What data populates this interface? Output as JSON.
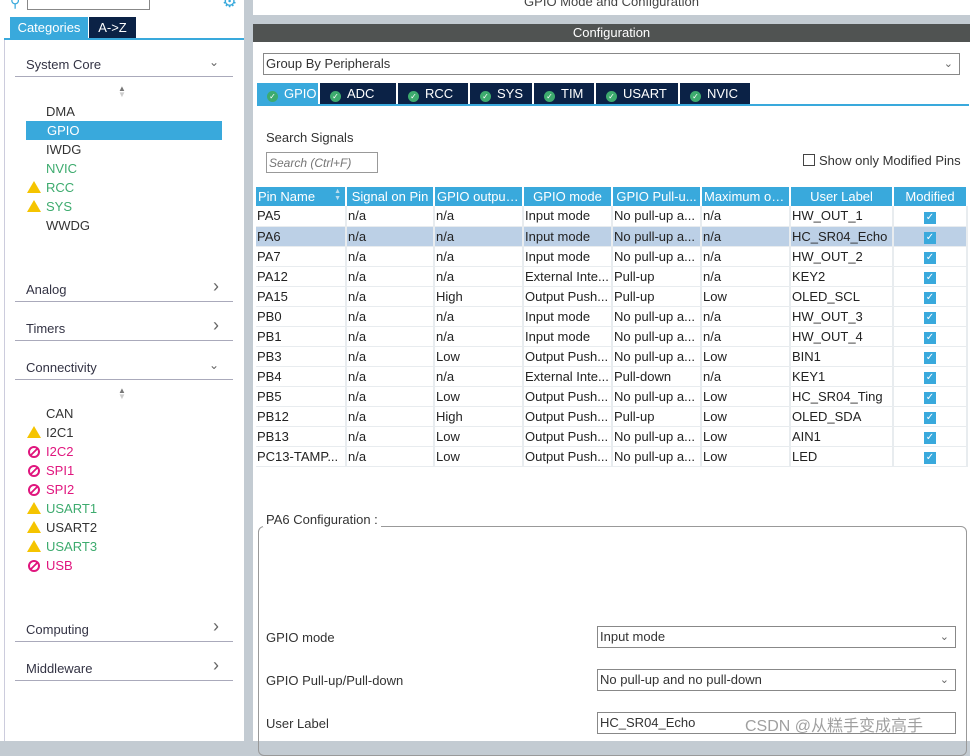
{
  "left": {
    "tabs": [
      {
        "label": "Categories",
        "active": true
      },
      {
        "label": "A->Z",
        "active": false
      }
    ],
    "categories": [
      {
        "label": "System Core",
        "expanded": true,
        "items": [
          {
            "label": "DMA",
            "status": "none",
            "color": "#333333"
          },
          {
            "label": "GPIO",
            "status": "none",
            "selected": true
          },
          {
            "label": "IWDG",
            "status": "none",
            "color": "#333333"
          },
          {
            "label": "NVIC",
            "status": "none",
            "color": "#3dab6e"
          },
          {
            "label": "RCC",
            "status": "warning",
            "color": "#3dab6e"
          },
          {
            "label": "SYS",
            "status": "warning",
            "color": "#3dab6e"
          },
          {
            "label": "WWDG",
            "status": "none",
            "color": "#333333"
          }
        ]
      },
      {
        "label": "Analog",
        "expanded": false
      },
      {
        "label": "Timers",
        "expanded": false
      },
      {
        "label": "Connectivity",
        "expanded": true,
        "items": [
          {
            "label": "CAN",
            "status": "none",
            "color": "#333333"
          },
          {
            "label": "I2C1",
            "status": "warning",
            "color": "#333333"
          },
          {
            "label": "I2C2",
            "status": "disabled",
            "color": "#e0167e"
          },
          {
            "label": "SPI1",
            "status": "disabled",
            "color": "#e0167e"
          },
          {
            "label": "SPI2",
            "status": "disabled",
            "color": "#e0167e"
          },
          {
            "label": "USART1",
            "status": "warning",
            "color": "#3dab6e"
          },
          {
            "label": "USART2",
            "status": "warning",
            "color": "#333333"
          },
          {
            "label": "USART3",
            "status": "warning",
            "color": "#3dab6e"
          },
          {
            "label": "USB",
            "status": "disabled",
            "color": "#e0167e"
          }
        ]
      },
      {
        "label": "Computing",
        "expanded": false
      },
      {
        "label": "Middleware",
        "expanded": false
      }
    ]
  },
  "right": {
    "title": "GPIO Mode and Configuration",
    "config_header": "Configuration",
    "group_by": "Group By Peripherals",
    "tabs": [
      "GPIO",
      "ADC",
      "RCC",
      "SYS",
      "TIM",
      "USART",
      "NVIC"
    ],
    "active_tab": "GPIO",
    "search_label": "Search Signals",
    "search_placeholder": "Search (Ctrl+F)",
    "show_modified_label": "Show only Modified Pins",
    "table": {
      "columns": [
        "Pin Name",
        "Signal on Pin",
        "GPIO output...",
        "GPIO mode",
        "GPIO Pull-u...",
        "Maximum ou...",
        "User Label",
        "Modified"
      ],
      "rows": [
        [
          "PA5",
          "n/a",
          "n/a",
          "Input mode",
          "No pull-up a...",
          "n/a",
          "HW_OUT_1",
          true
        ],
        [
          "PA6",
          "n/a",
          "n/a",
          "Input mode",
          "No pull-up a...",
          "n/a",
          "HC_SR04_Echo",
          true
        ],
        [
          "PA7",
          "n/a",
          "n/a",
          "Input mode",
          "No pull-up a...",
          "n/a",
          "HW_OUT_2",
          true
        ],
        [
          "PA12",
          "n/a",
          "n/a",
          "External Inte...",
          "Pull-up",
          "n/a",
          "KEY2",
          true
        ],
        [
          "PA15",
          "n/a",
          "High",
          "Output Push...",
          "Pull-up",
          "Low",
          "OLED_SCL",
          true
        ],
        [
          "PB0",
          "n/a",
          "n/a",
          "Input mode",
          "No pull-up a...",
          "n/a",
          "HW_OUT_3",
          true
        ],
        [
          "PB1",
          "n/a",
          "n/a",
          "Input mode",
          "No pull-up a...",
          "n/a",
          "HW_OUT_4",
          true
        ],
        [
          "PB3",
          "n/a",
          "Low",
          "Output Push...",
          "No pull-up a...",
          "Low",
          "BIN1",
          true
        ],
        [
          "PB4",
          "n/a",
          "n/a",
          "External Inte...",
          "Pull-down",
          "n/a",
          "KEY1",
          true
        ],
        [
          "PB5",
          "n/a",
          "Low",
          "Output Push...",
          "No pull-up a...",
          "Low",
          "HC_SR04_Ting",
          true
        ],
        [
          "PB12",
          "n/a",
          "High",
          "Output Push...",
          "Pull-up",
          "Low",
          "OLED_SDA",
          true
        ],
        [
          "PB13",
          "n/a",
          "Low",
          "Output Push...",
          "No pull-up a...",
          "Low",
          "AIN1",
          true
        ],
        [
          "PC13-TAMP...",
          "n/a",
          "Low",
          "Output Push...",
          "No pull-up a...",
          "Low",
          "LED",
          true
        ]
      ],
      "selected_row": 1
    },
    "pin_config": {
      "title": "PA6 Configuration :",
      "fields": [
        {
          "label": "GPIO mode",
          "value": "Input mode",
          "type": "select"
        },
        {
          "label": "GPIO Pull-up/Pull-down",
          "value": "No pull-up and no pull-down",
          "type": "select"
        },
        {
          "label": "User Label",
          "value": "HC_SR04_Echo",
          "type": "text"
        }
      ]
    }
  },
  "watermark": "CSDN @从糕手变成高手",
  "colors": {
    "accent": "#39a9dc",
    "navy": "#0b2246",
    "ok": "#3dab6e",
    "error": "#e0167e",
    "warning": "#f5c400"
  }
}
